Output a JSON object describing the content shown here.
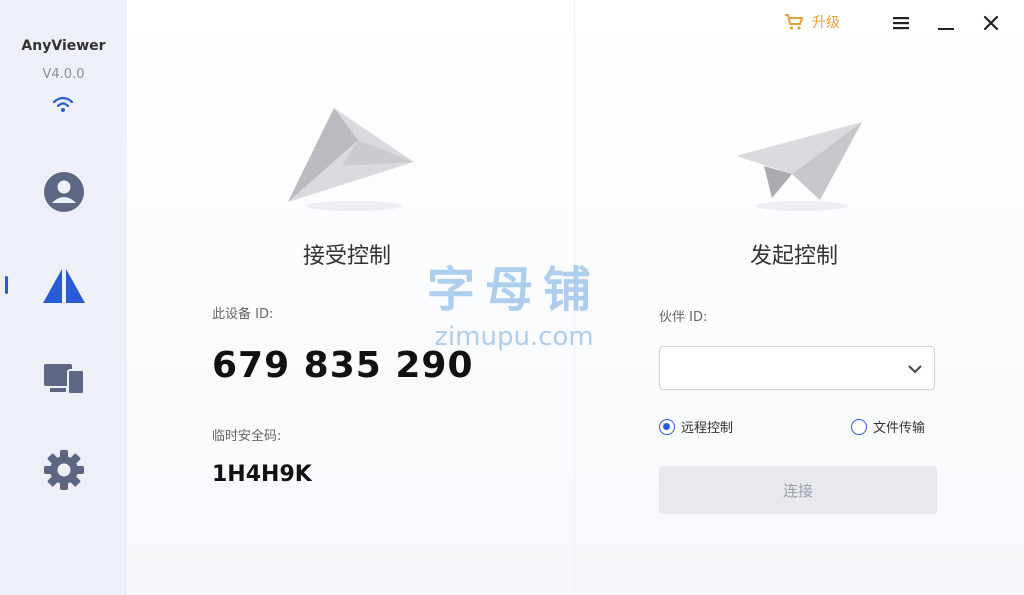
{
  "sidebar": {
    "app_name": "AnyViewer",
    "version": "V4.0.0",
    "items": [
      {
        "name": "account",
        "icon": "user-circle-icon"
      },
      {
        "name": "remote-control",
        "icon": "anyviewer-logo-icon",
        "active": true
      },
      {
        "name": "devices",
        "icon": "devices-icon"
      },
      {
        "name": "settings",
        "icon": "gear-icon"
      }
    ]
  },
  "topbar": {
    "upgrade_label": "升级",
    "upgrade_icon": "cart-icon",
    "menu_icon": "menu-icon",
    "minimize_icon": "minimize-icon",
    "close_icon": "close-icon"
  },
  "receive": {
    "title": "接受控制",
    "device_id_label": "此设备 ID:",
    "device_id": "679 835 290",
    "code_label": "临时安全码:",
    "code": "1H4H9K"
  },
  "initiate": {
    "title": "发起控制",
    "partner_id_label": "伙伴 ID:",
    "partner_id_value": "",
    "options": [
      {
        "label": "远程控制",
        "selected": true
      },
      {
        "label": "文件传输",
        "selected": false
      }
    ],
    "connect_label": "连接"
  },
  "watermark": {
    "cn": "字母铺",
    "en": "zimupu.com"
  },
  "colors": {
    "accent": "#2a5bd7",
    "upgrade": "#e8a23a",
    "sidebar_bg": "#eef0f7",
    "nav_icon": "#5d6784"
  }
}
